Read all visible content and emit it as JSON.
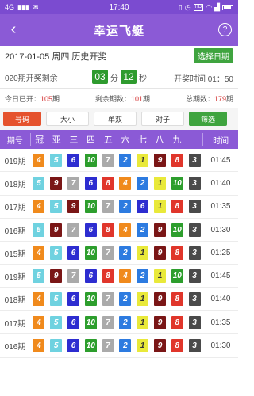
{
  "status_bar": {
    "carrier": "4G",
    "time": "17:40",
    "hd": "HD"
  },
  "header": {
    "title": "幸运飞艇",
    "back_icon": "‹",
    "help_icon": "?"
  },
  "info": {
    "date_line": "2017-01-05  周四  历史开奖",
    "select_date_label": "选择日期",
    "countdown_label": "020期开奖剩余",
    "minutes": "03",
    "minutes_unit": "分",
    "seconds": "12",
    "seconds_unit": "秒",
    "open_time": "开奖时间 01：50",
    "opened_prefix": "今日已开：",
    "opened_count": "105",
    "opened_suffix": "期",
    "remain_prefix": "剩余期数：",
    "remain_count": "101",
    "remain_suffix": "期",
    "total_prefix": "总期数：",
    "total_count": "179",
    "total_suffix": "期"
  },
  "tabs": [
    "号码",
    "大小",
    "单双",
    "对子",
    "筛选"
  ],
  "table": {
    "head": {
      "issue": "期号",
      "positions": [
        "冠",
        "亚",
        "三",
        "四",
        "五",
        "六",
        "七",
        "八",
        "九",
        "十"
      ],
      "time": "时间"
    },
    "rows": [
      {
        "issue": "019期",
        "balls": [
          4,
          5,
          6,
          10,
          7,
          2,
          1,
          9,
          8,
          3
        ],
        "time": "01:45"
      },
      {
        "issue": "018期",
        "balls": [
          5,
          9,
          7,
          6,
          8,
          4,
          2,
          1,
          10,
          3
        ],
        "time": "01:40"
      },
      {
        "issue": "017期",
        "balls": [
          4,
          5,
          9,
          10,
          7,
          2,
          6,
          1,
          8,
          3
        ],
        "time": "01:35"
      },
      {
        "issue": "016期",
        "balls": [
          5,
          9,
          7,
          6,
          8,
          4,
          2,
          9,
          10,
          3
        ],
        "time": "01:30"
      },
      {
        "issue": "015期",
        "balls": [
          4,
          5,
          6,
          10,
          7,
          2,
          1,
          9,
          8,
          3
        ],
        "time": "01:25"
      },
      {
        "issue": "019期",
        "balls": [
          5,
          9,
          7,
          6,
          8,
          4,
          2,
          1,
          10,
          3
        ],
        "time": "01:45"
      },
      {
        "issue": "018期",
        "balls": [
          4,
          5,
          6,
          10,
          7,
          2,
          1,
          9,
          8,
          3
        ],
        "time": "01:40"
      },
      {
        "issue": "017期",
        "balls": [
          4,
          5,
          6,
          10,
          7,
          2,
          1,
          9,
          8,
          3
        ],
        "time": "01:35"
      },
      {
        "issue": "016期",
        "balls": [
          4,
          5,
          6,
          10,
          7,
          2,
          1,
          9,
          8,
          3
        ],
        "time": "01:30"
      }
    ]
  },
  "ball_colors": {
    "1": "#e9e93a",
    "2": "#2d7be0",
    "3": "#4a4a4a",
    "4": "#f08a1c",
    "5": "#6fd2e0",
    "6": "#2d2dd0",
    "7": "#aaaaaa",
    "8": "#e0362b",
    "9": "#7a1616",
    "10": "#2d9e2d"
  }
}
